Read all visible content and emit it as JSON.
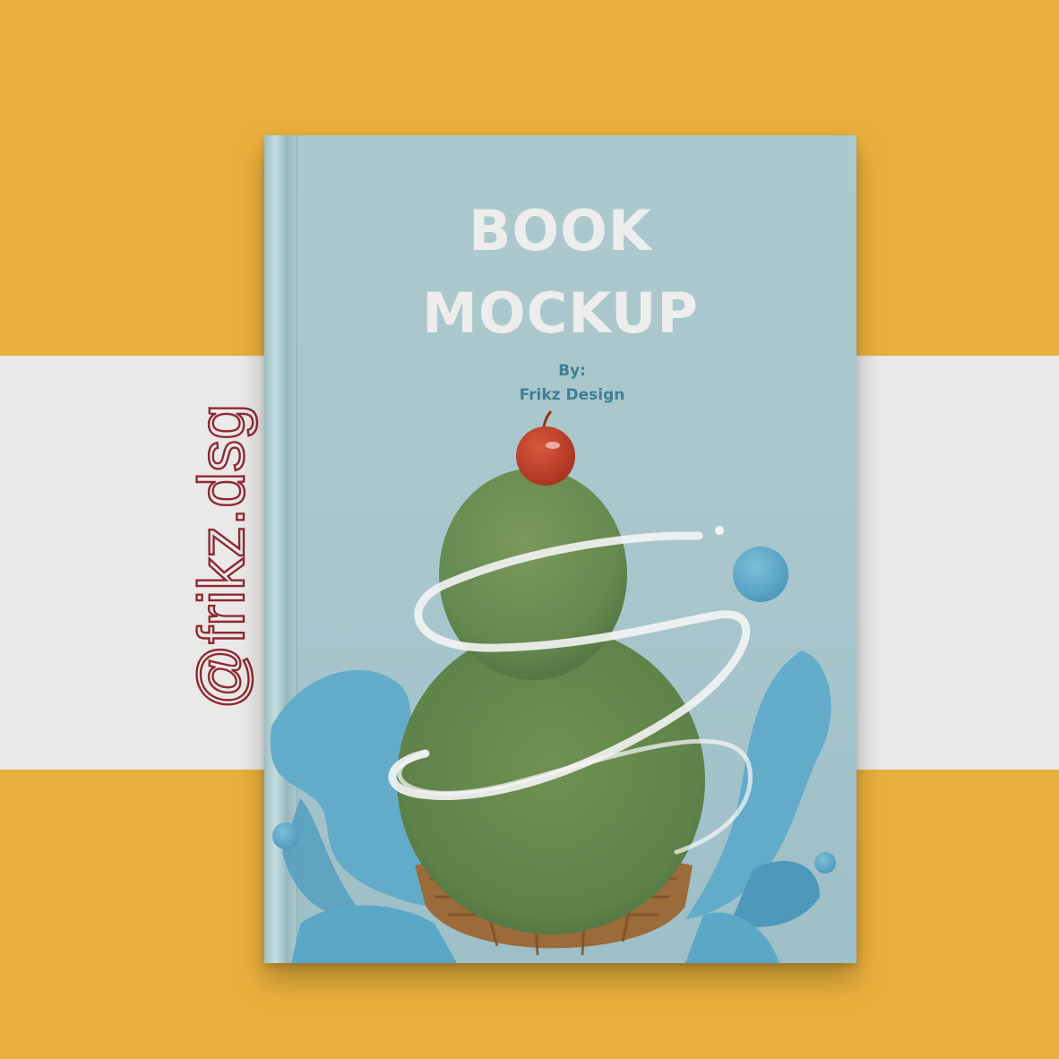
{
  "handle": {
    "text": "@frikz.dsg"
  },
  "book": {
    "title_line1": "BOOK",
    "title_line2": "MOCKUP",
    "byline_label": "By:",
    "author": "Frikz Design"
  },
  "illustration": {
    "subject": "ice cream cone with two green scoops and a cherry, water splash"
  },
  "colors": {
    "background": "#e8af3c",
    "band": "#ebe9e8",
    "cover": "#acc9cd",
    "handle_text": "#8e2a35",
    "scoop": "#6a8b4f",
    "cherry": "#c4452e",
    "splash": "#5aa9c8"
  }
}
